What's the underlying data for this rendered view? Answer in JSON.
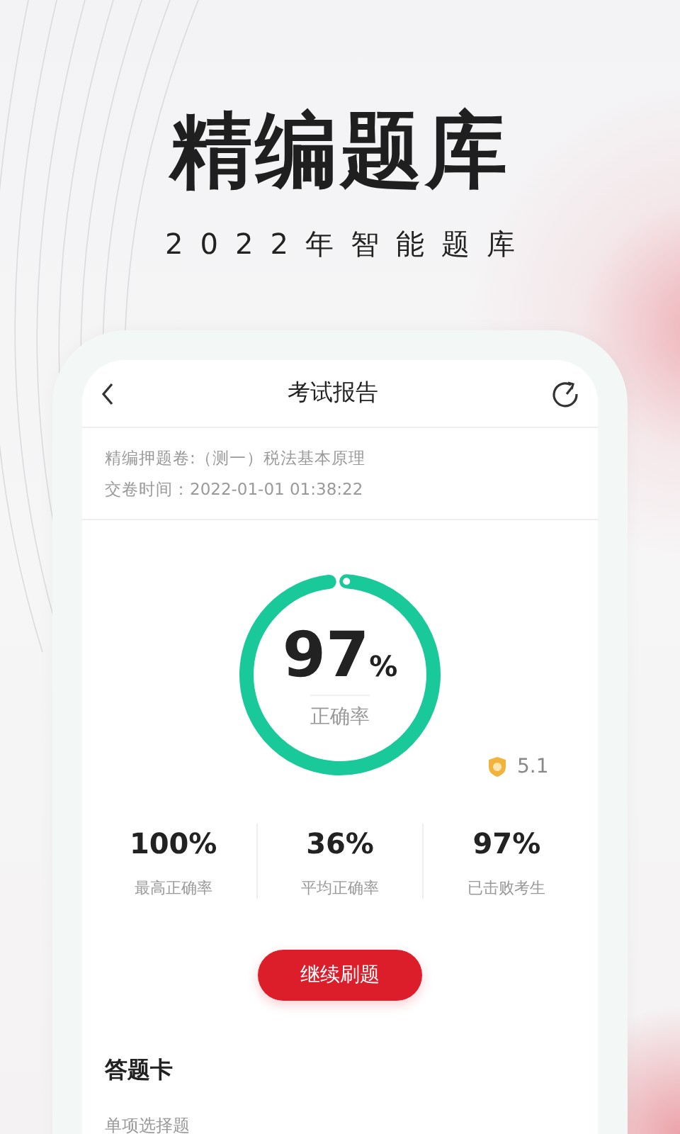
{
  "hero": {
    "title": "精编题库",
    "subtitle": "2022年智能题库"
  },
  "screen": {
    "title": "考试报告",
    "paper": "精编押题卷:（测一）税法基本原理",
    "submit_time": "交卷时间：2022-01-01 01:38:22",
    "score": {
      "value": "97",
      "unit": "%",
      "label": "正确率",
      "level": 0.97
    },
    "badge": "5.1",
    "stats": [
      {
        "value": "100%",
        "label": "最高正确率"
      },
      {
        "value": "36%",
        "label": "平均正确率"
      },
      {
        "value": "97%",
        "label": "已击败考生"
      }
    ],
    "button": "继续刷题",
    "section": "答题卡",
    "subsection": "单项选择题"
  }
}
